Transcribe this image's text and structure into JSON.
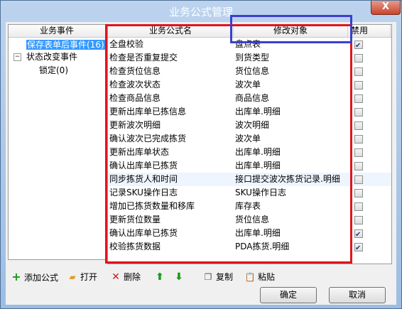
{
  "window": {
    "title": "业务公式管理",
    "close_label": "X"
  },
  "tree": {
    "header": "业务事件",
    "items": [
      {
        "label": "保存表单后事件(16)",
        "selected": true
      },
      {
        "label": "状态改变事件",
        "expander": "−"
      },
      {
        "label": "锁定(0)"
      }
    ]
  },
  "grid": {
    "headers": {
      "name": "业务公式名",
      "target": "修改对象",
      "disabled": "禁用"
    },
    "rows": [
      {
        "name": "全盘校验",
        "target": "盘点表",
        "disabled": true
      },
      {
        "name": "检查是否重复提交",
        "target": "到货类型",
        "disabled": false
      },
      {
        "name": "检查货位信息",
        "target": "货位信息",
        "disabled": false
      },
      {
        "name": "检查波次状态",
        "target": "波次单",
        "disabled": false
      },
      {
        "name": "检查商品信息",
        "target": "商品信息",
        "disabled": false
      },
      {
        "name": "更新出库单已拣信息",
        "target": "出库单.明细",
        "disabled": false
      },
      {
        "name": "更新波次明细",
        "target": "波次明细",
        "disabled": false
      },
      {
        "name": "确认波次已完成拣货",
        "target": "波次单",
        "disabled": false
      },
      {
        "name": "更新出库单状态",
        "target": "出库单.明细",
        "disabled": false
      },
      {
        "name": "确认出库单已拣货",
        "target": "出库单.明细",
        "disabled": false
      },
      {
        "name": "同步拣货人和时间",
        "target": "接口提交波次拣货记录.明细",
        "disabled": false
      },
      {
        "name": "记录SKU操作日志",
        "target": "SKU操作日志",
        "disabled": false
      },
      {
        "name": "增加已拣货数量和移库",
        "target": "库存表",
        "disabled": false
      },
      {
        "name": "更新货位数量",
        "target": "货位信息",
        "disabled": false
      },
      {
        "name": "确认出库单已拣货",
        "target": "出库单.明细",
        "disabled": true
      },
      {
        "name": "校验拣货数据",
        "target": "PDA拣货.明细",
        "disabled": true
      }
    ]
  },
  "toolbar": {
    "add": {
      "label": "添加公式",
      "icon": "plus-icon"
    },
    "open": {
      "label": "打开",
      "icon": "folder-icon"
    },
    "delete": {
      "label": "删除",
      "icon": "x-icon"
    },
    "up": {
      "icon": "arrow-up-icon"
    },
    "down": {
      "icon": "arrow-down-icon"
    },
    "copy": {
      "label": "复制",
      "icon": "copy-icon"
    },
    "paste": {
      "label": "粘贴",
      "icon": "paste-icon"
    }
  },
  "buttons": {
    "ok": "确定",
    "cancel": "取消"
  },
  "colors": {
    "highlight_red": "#e0141c",
    "highlight_blue": "#3b3fcb",
    "selection": "#3399ff"
  }
}
